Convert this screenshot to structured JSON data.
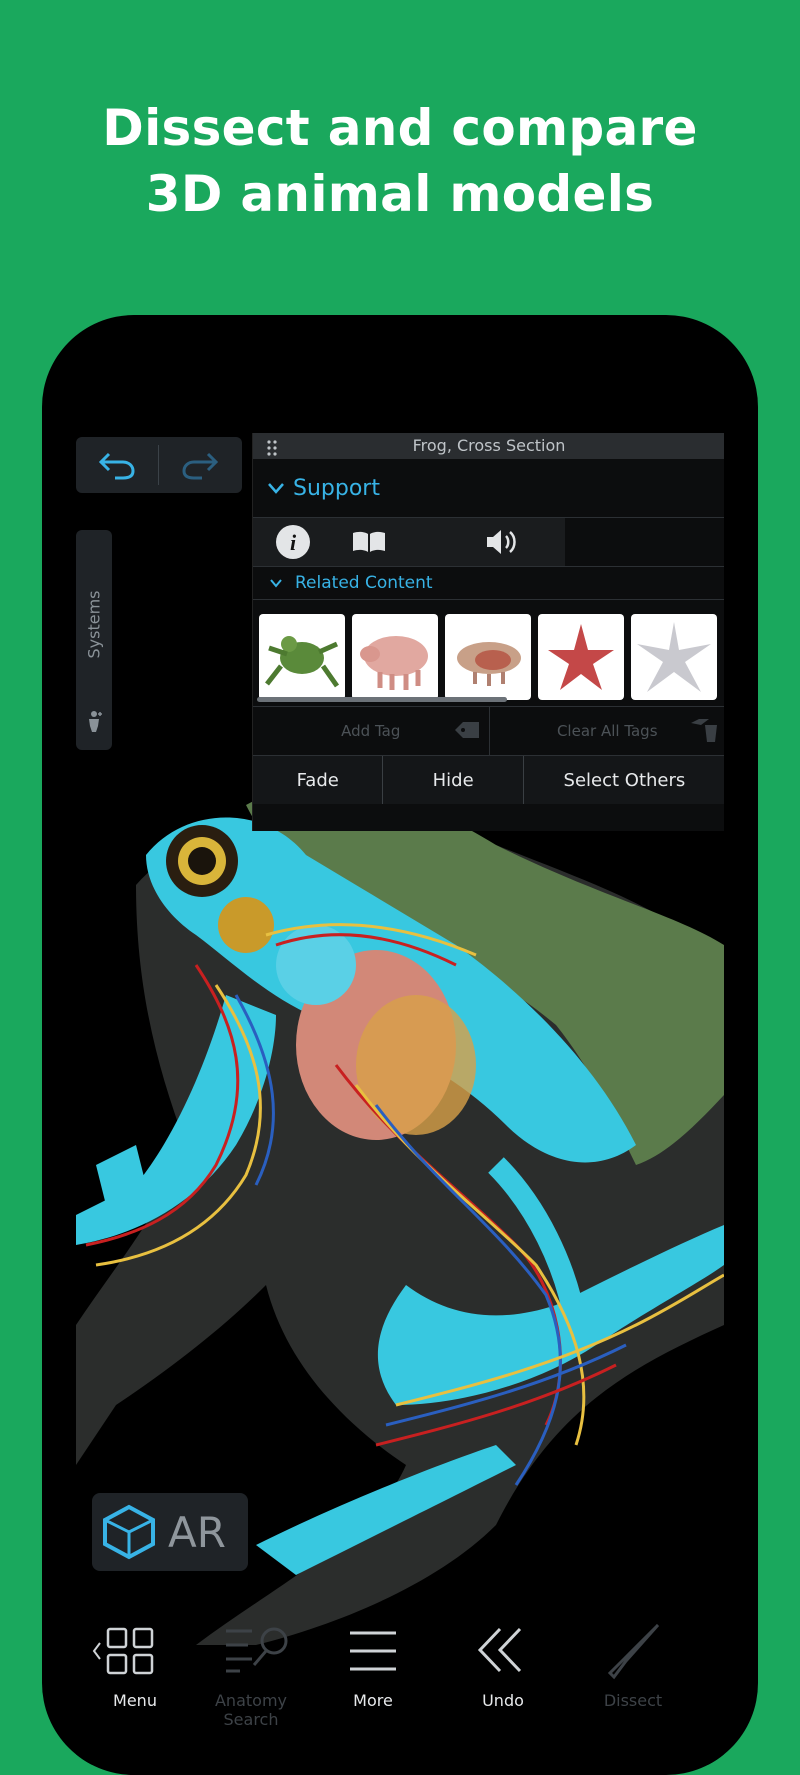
{
  "headline": {
    "line1": "Dissect and compare",
    "line2": "3D animal models"
  },
  "panel": {
    "title": "Frog, Cross Section",
    "section": "Support",
    "related_label": "Related Content",
    "thumbnails": [
      "frog",
      "pig",
      "fetal pig dissection",
      "sea star",
      "sea star skeleton"
    ],
    "add_tag": "Add Tag",
    "clear_tags": "Clear All Tags",
    "actions": {
      "fade": "Fade",
      "hide": "Hide",
      "select_others": "Select Others"
    }
  },
  "sidebar": {
    "systems_label": "Systems"
  },
  "ar": {
    "label": "AR"
  },
  "nav": {
    "menu": "Menu",
    "search": "Anatomy Search",
    "more": "More",
    "undo": "Undo",
    "dissect": "Dissect"
  },
  "colors": {
    "background": "#1aa85d",
    "accent": "#38b3e6"
  }
}
